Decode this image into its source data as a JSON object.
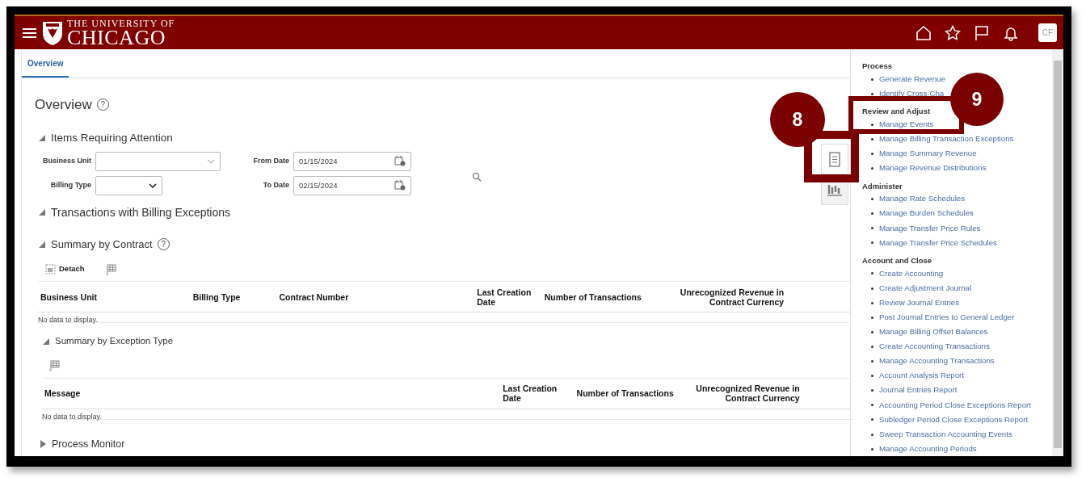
{
  "header": {
    "logo_line1": "THE UNIVERSITY OF",
    "logo_line2": "CHICAGO",
    "avatar": "CF"
  },
  "tabs": [
    {
      "label": "Overview",
      "selected": true
    }
  ],
  "page_title": "Overview",
  "page_help": "?",
  "items_requiring_attention": {
    "title": "Items Requiring Attention",
    "expanded": true,
    "fields": [
      {
        "label": "Business Unit",
        "kind": "combo"
      },
      {
        "label": "From Date",
        "kind": "date",
        "value": "01/15/2024"
      },
      {
        "label": "Billing Type",
        "kind": "select"
      },
      {
        "label": "To Date",
        "kind": "date",
        "value": "02/15/2024"
      }
    ]
  },
  "transactions_section": {
    "title": "Transactions with Billing Exceptions",
    "expanded": true
  },
  "summary_by_contract": {
    "title": "Summary by Contract",
    "help": "?",
    "expanded": true,
    "detach": "Detach",
    "columns": [
      "Business Unit",
      "Billing Type",
      "Contract Number",
      "Last Creation Date",
      "Number of Transactions",
      "Unrecognized Revenue in Contract Currency"
    ],
    "empty_text": "No data to display."
  },
  "summary_by_exception_type": {
    "title": "Summary by Exception Type",
    "expanded": true,
    "columns": [
      "Message",
      "Last Creation Date",
      "Number of Transactions",
      "Unrecognized Revenue in Contract Currency"
    ],
    "empty_text": "No data to display."
  },
  "process_monitor": {
    "title": "Process Monitor",
    "expanded": false
  },
  "task_panel": {
    "groups": [
      {
        "title": "Process",
        "items": [
          "Generate Revenue",
          "Identify Cross-Cha"
        ]
      },
      {
        "title": "Review and Adjust",
        "items": [
          "Manage Events",
          "Manage Billing Transaction Exceptions",
          "Manage Summary Revenue",
          "Manage Revenue Distributions"
        ]
      },
      {
        "title": "Administer",
        "items": [
          "Manage Rate Schedules",
          "Manage Burden Schedules",
          "Manage Transfer Price Rules",
          "Manage Transfer Price Schedules"
        ]
      },
      {
        "title": "Account and Close",
        "items": [
          "Create Accounting",
          "Create Adjustment Journal",
          "Review Journal Entries",
          "Post Journal Entries to General Ledger",
          "Manage Billing Offset Balances",
          "Create Accounting Transactions",
          "Manage Accounting Transactions",
          "Account Analysis Report",
          "Journal Entries Report",
          "Accounting Period Close Exceptions Report",
          "Subledger Period Close Exceptions Report",
          "Sweep Transaction Accounting Events",
          "Manage Accounting Periods"
        ]
      }
    ]
  },
  "annotations": [
    {
      "label": "8"
    },
    {
      "label": "9"
    }
  ]
}
